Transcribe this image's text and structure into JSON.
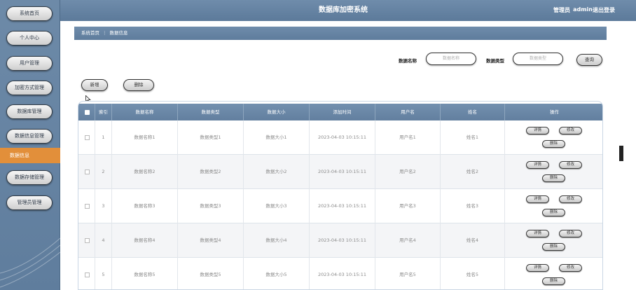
{
  "header": {
    "title": "数据库加密系统",
    "admin_label": "管理员",
    "admin_name": "admin",
    "logout": "退出登录"
  },
  "sidebar": {
    "items": [
      {
        "label": "系统首页"
      },
      {
        "label": "个人中心"
      },
      {
        "label": "用户管理"
      },
      {
        "label": "加密方式管理"
      },
      {
        "label": "数据库管理"
      },
      {
        "label": "数据信息管理"
      },
      {
        "label": "数据存储管理"
      },
      {
        "label": "管理员管理"
      }
    ],
    "active_label": "数据信息"
  },
  "breadcrumb": {
    "home": "系统首页",
    "separator": "⋮",
    "current": "数据信息"
  },
  "search": {
    "name_label": "数据名称",
    "name_placeholder": "数据名称",
    "type_label": "数据类型",
    "type_placeholder": "数据类型",
    "query_button": "查询"
  },
  "actions": {
    "add_button": "新增",
    "delete_button": "删除"
  },
  "table": {
    "columns": [
      "索引",
      "数据名称",
      "数据类型",
      "数据大小",
      "添加时间",
      "用户名",
      "姓名",
      "操作"
    ],
    "rows": [
      {
        "index": "1",
        "name": "数据名称1",
        "type": "数据类型1",
        "size": "数据大小1",
        "time": "2023-04-03 10:15:11",
        "username": "用户名1",
        "realname": "姓名1"
      },
      {
        "index": "2",
        "name": "数据名称2",
        "type": "数据类型2",
        "size": "数据大小2",
        "time": "2023-04-03 10:15:11",
        "username": "用户名2",
        "realname": "姓名2"
      },
      {
        "index": "3",
        "name": "数据名称3",
        "type": "数据类型3",
        "size": "数据大小3",
        "time": "2023-04-03 10:15:11",
        "username": "用户名3",
        "realname": "姓名3"
      },
      {
        "index": "4",
        "name": "数据名称4",
        "type": "数据类型4",
        "size": "数据大小4",
        "time": "2023-04-03 10:15:11",
        "username": "用户名4",
        "realname": "姓名4"
      },
      {
        "index": "5",
        "name": "数据名称5",
        "type": "数据类型5",
        "size": "数据大小5",
        "time": "2023-04-03 10:15:11",
        "username": "用户名5",
        "realname": "姓名5"
      }
    ],
    "op_labels": {
      "detail": "详情",
      "edit": "修改",
      "delete": "删除"
    }
  },
  "colors": {
    "sidebar": "#6d8aa8",
    "header": "#6f8cab",
    "active_item": "#e28f3a"
  }
}
